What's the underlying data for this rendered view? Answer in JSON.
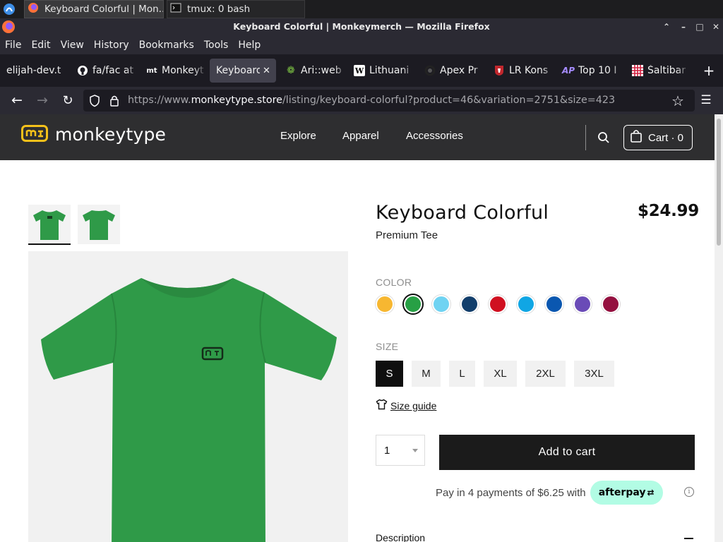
{
  "taskbar": {
    "tasks": [
      {
        "label": "Keyboard Colorful | Mon..."
      },
      {
        "label": "tmux: 0 bash"
      }
    ]
  },
  "window": {
    "title": "Keyboard Colorful | Monkeymerch — Mozilla Firefox"
  },
  "menubar": {
    "items": [
      "File",
      "Edit",
      "View",
      "History",
      "Bookmarks",
      "Tools",
      "Help"
    ]
  },
  "tabs": [
    {
      "label": "elijah-dev.t",
      "icon": "site-icon"
    },
    {
      "label": "fa/fac at",
      "icon": "github-icon"
    },
    {
      "label": "Monkeyt",
      "icon": "monkeytype-icon"
    },
    {
      "label": "Keyboard",
      "icon": "",
      "active": true
    },
    {
      "label": "Ari::web",
      "icon": "leaf-icon"
    },
    {
      "label": "Lithuani",
      "icon": "wikipedia-icon"
    },
    {
      "label": "Apex Pr",
      "icon": "apex-icon"
    },
    {
      "label": "LR Kons",
      "icon": "coat-of-arms-icon"
    },
    {
      "label": "Top 10 I",
      "icon": "ap-icon"
    },
    {
      "label": "Šaltibar",
      "icon": "grid-icon"
    }
  ],
  "navbar": {
    "url_prefix": "https://www.",
    "url_domain": "monkeytype.store",
    "url_path": "/listing/keyboard-colorful?product=46&variation=2751&size=423"
  },
  "site": {
    "logo_text": "monkeytype",
    "nav": [
      "Explore",
      "Apparel",
      "Accessories"
    ],
    "cart_label": "Cart · 0"
  },
  "product": {
    "title": "Keyboard Colorful",
    "subtitle": "Premium Tee",
    "price": "$24.99",
    "color_label": "COLOR",
    "colors": [
      "#f7b731",
      "#27a045",
      "#6fd3f2",
      "#123e6b",
      "#d01020",
      "#10a6e4",
      "#0a57b0",
      "#6a4bb7",
      "#94103f"
    ],
    "selected_color_index": 1,
    "size_label": "SIZE",
    "sizes": [
      "S",
      "M",
      "L",
      "XL",
      "2XL",
      "3XL"
    ],
    "selected_size": "S",
    "size_guide": "Size guide",
    "quantity": "1",
    "add_to_cart": "Add to cart",
    "afterpay_text": "Pay in 4 payments of $6.25 with",
    "afterpay_badge": "afterpay",
    "description_label": "Description",
    "shirt_color": "#2f9a48"
  }
}
